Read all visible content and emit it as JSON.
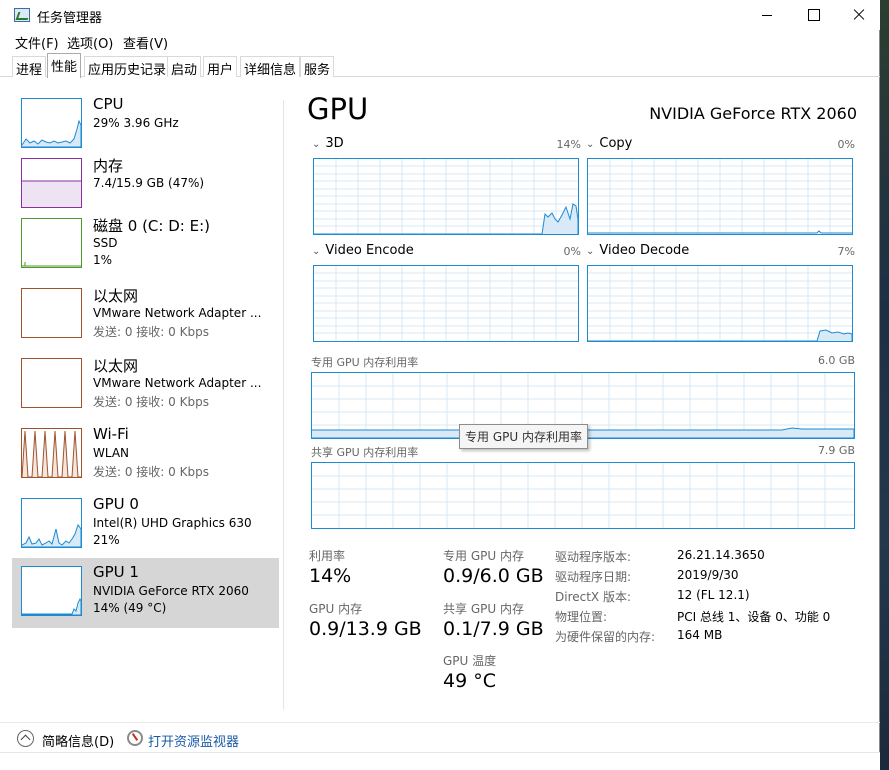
{
  "window": {
    "title": "任务管理器",
    "colors": {
      "accent": "#1e8ad2",
      "memory": "#8a2ea0",
      "disk": "#4d9a2a",
      "network": "#a0522d",
      "selection": "#d6d6d6"
    }
  },
  "menu": [
    "文件(F)",
    "选项(O)",
    "查看(V)"
  ],
  "tabs": [
    {
      "label": "进程",
      "active": false
    },
    {
      "label": "性能",
      "active": true
    },
    {
      "label": "应用历史记录",
      "active": false
    },
    {
      "label": "启动",
      "active": false
    },
    {
      "label": "用户",
      "active": false
    },
    {
      "label": "详细信息",
      "active": false
    },
    {
      "label": "服务",
      "active": false
    }
  ],
  "sidebar": {
    "items": [
      {
        "title": "CPU",
        "line1": "29% 3.96 GHz",
        "line2": "",
        "color": "#1e8ad2",
        "icon": "cpu-graph"
      },
      {
        "title": "内存",
        "line1": "7.4/15.9 GB (47%)",
        "line2": "",
        "color": "#8a2ea0",
        "icon": "memory-graph"
      },
      {
        "title": "磁盘 0 (C: D: E:)",
        "line1": "SSD",
        "line2": "1%",
        "color": "#4d9a2a",
        "icon": "disk-graph"
      },
      {
        "title": "以太网",
        "line1": "VMware Network Adapter ...",
        "line2": "发送: 0 接收: 0 Kbps",
        "color": "#a0522d",
        "icon": "ethernet-graph"
      },
      {
        "title": "以太网",
        "line1": "VMware Network Adapter ...",
        "line2": "发送: 0 接收: 0 Kbps",
        "color": "#a0522d",
        "icon": "ethernet-graph"
      },
      {
        "title": "Wi-Fi",
        "line1": "WLAN",
        "line2": "发送: 0 接收: 0 Kbps",
        "color": "#a0522d",
        "icon": "wifi-graph"
      },
      {
        "title": "GPU 0",
        "line1": "Intel(R) UHD Graphics 630",
        "line2": "21%",
        "color": "#1e8ad2",
        "icon": "gpu0-graph"
      },
      {
        "title": "GPU 1",
        "line1": "NVIDIA GeForce RTX 2060",
        "line2": "14% (49 °C)",
        "color": "#1e8ad2",
        "icon": "gpu1-graph",
        "selected": true
      }
    ]
  },
  "main": {
    "title": "GPU",
    "model": "NVIDIA GeForce RTX 2060",
    "engines": [
      {
        "label": "3D",
        "percent": "14%"
      },
      {
        "label": "Copy",
        "percent": "0%"
      },
      {
        "label": "Video Encode",
        "percent": "0%"
      },
      {
        "label": "Video Decode",
        "percent": "7%"
      }
    ],
    "dedicated_memory": {
      "label": "专用 GPU 内存利用率",
      "max": "6.0 GB"
    },
    "shared_memory": {
      "label": "共享 GPU 内存利用率",
      "max": "7.9 GB"
    },
    "tooltip": "专用 GPU 内存利用率",
    "stats": {
      "utilization_label": "利用率",
      "utilization_value": "14%",
      "dedicated_label": "专用 GPU 内存",
      "dedicated_value": "0.9/6.0 GB",
      "gpu_mem_label": "GPU 内存",
      "gpu_mem_value": "0.9/13.9 GB",
      "shared_label": "共享 GPU 内存",
      "shared_value": "0.1/7.9 GB",
      "temp_label": "GPU 温度",
      "temp_value": "49 °C"
    },
    "info": [
      {
        "key": "驱动程序版本:",
        "value": "26.21.14.3650"
      },
      {
        "key": "驱动程序日期:",
        "value": "2019/9/30"
      },
      {
        "key": "DirectX 版本:",
        "value": "12 (FL 12.1)"
      },
      {
        "key": "物理位置:",
        "value": "PCI 总线 1、设备 0、功能 0"
      },
      {
        "key": "为硬件保留的内存:",
        "value": "164 MB"
      }
    ]
  },
  "footer": {
    "fewer_details": "简略信息(D)",
    "open_monitor": "打开资源监视器"
  }
}
